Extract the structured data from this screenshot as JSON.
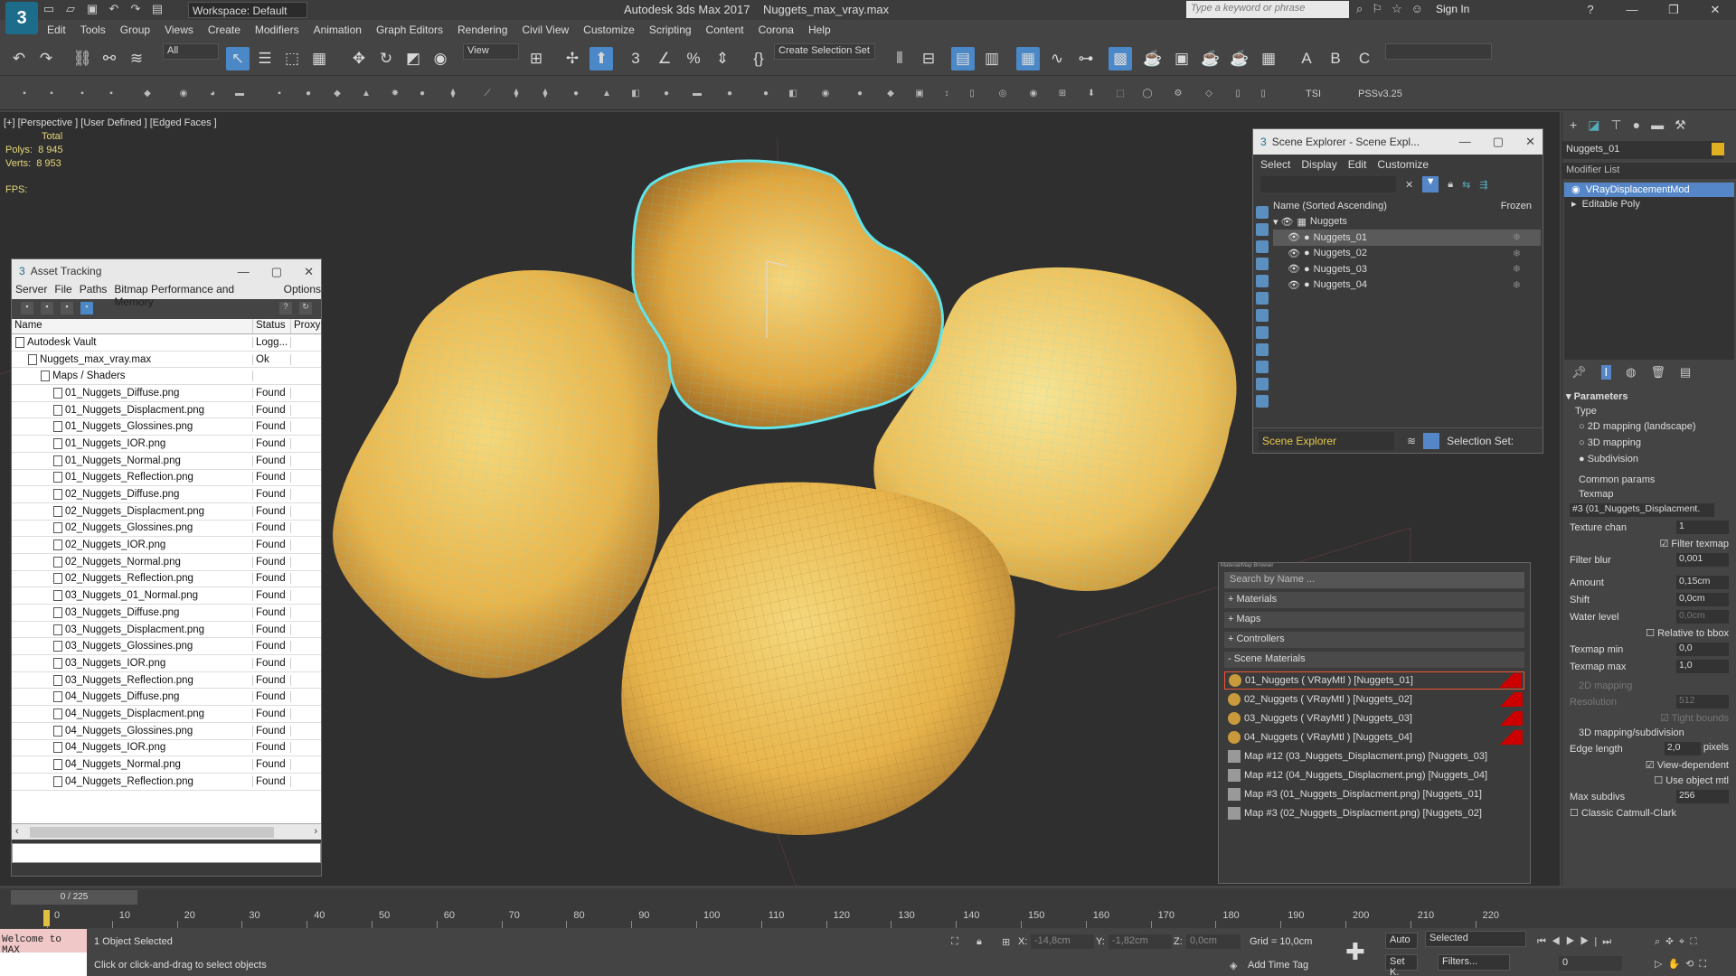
{
  "titlebar": {
    "workspace": "Workspace: Default",
    "app_name": "Autodesk 3ds Max 2017",
    "file_name": "Nuggets_max_vray.max",
    "search_placeholder": "Type a keyword or phrase",
    "sign_in": "Sign In"
  },
  "menu": [
    "Edit",
    "Tools",
    "Group",
    "Views",
    "Create",
    "Modifiers",
    "Animation",
    "Graph Editors",
    "Rendering",
    "Civil View",
    "Customize",
    "Scripting",
    "Content",
    "Corona",
    "Help"
  ],
  "toolbar": {
    "filter_all": "All",
    "ref_coord": "View",
    "selection_set": "Create Selection Set",
    "tsi_label": "TSI",
    "pss_label": "PSSv3.25"
  },
  "viewport": {
    "label": "[+] [Perspective ] [User Defined ] [Edged Faces ]",
    "total_label": "Total",
    "polys_label": "Polys:",
    "polys_value": "8 945",
    "verts_label": "Verts:",
    "verts_value": "8 953",
    "fps_label": "FPS:"
  },
  "asset_tracking": {
    "title": "Asset Tracking",
    "menu": [
      "Server",
      "File",
      "Paths",
      "Bitmap Performance and Memory",
      "Options"
    ],
    "col_name": "Name",
    "col_status": "Status",
    "col_proxy": "Proxy",
    "rows": [
      {
        "name": "Autodesk Vault",
        "status": "Logg...",
        "indent": 0
      },
      {
        "name": "Nuggets_max_vray.max",
        "status": "Ok",
        "indent": 1
      },
      {
        "name": "Maps / Shaders",
        "status": "",
        "indent": 2
      },
      {
        "name": "01_Nuggets_Diffuse.png",
        "status": "Found",
        "indent": 3
      },
      {
        "name": "01_Nuggets_Displacment.png",
        "status": "Found",
        "indent": 3
      },
      {
        "name": "01_Nuggets_Glossines.png",
        "status": "Found",
        "indent": 3
      },
      {
        "name": "01_Nuggets_IOR.png",
        "status": "Found",
        "indent": 3
      },
      {
        "name": "01_Nuggets_Normal.png",
        "status": "Found",
        "indent": 3
      },
      {
        "name": "01_Nuggets_Reflection.png",
        "status": "Found",
        "indent": 3
      },
      {
        "name": "02_Nuggets_Diffuse.png",
        "status": "Found",
        "indent": 3
      },
      {
        "name": "02_Nuggets_Displacment.png",
        "status": "Found",
        "indent": 3
      },
      {
        "name": "02_Nuggets_Glossines.png",
        "status": "Found",
        "indent": 3
      },
      {
        "name": "02_Nuggets_IOR.png",
        "status": "Found",
        "indent": 3
      },
      {
        "name": "02_Nuggets_Normal.png",
        "status": "Found",
        "indent": 3
      },
      {
        "name": "02_Nuggets_Reflection.png",
        "status": "Found",
        "indent": 3
      },
      {
        "name": "03_Nuggets_01_Normal.png",
        "status": "Found",
        "indent": 3
      },
      {
        "name": "03_Nuggets_Diffuse.png",
        "status": "Found",
        "indent": 3
      },
      {
        "name": "03_Nuggets_Displacment.png",
        "status": "Found",
        "indent": 3
      },
      {
        "name": "03_Nuggets_Glossines.png",
        "status": "Found",
        "indent": 3
      },
      {
        "name": "03_Nuggets_IOR.png",
        "status": "Found",
        "indent": 3
      },
      {
        "name": "03_Nuggets_Reflection.png",
        "status": "Found",
        "indent": 3
      },
      {
        "name": "04_Nuggets_Diffuse.png",
        "status": "Found",
        "indent": 3
      },
      {
        "name": "04_Nuggets_Displacment.png",
        "status": "Found",
        "indent": 3
      },
      {
        "name": "04_Nuggets_Glossines.png",
        "status": "Found",
        "indent": 3
      },
      {
        "name": "04_Nuggets_IOR.png",
        "status": "Found",
        "indent": 3
      },
      {
        "name": "04_Nuggets_Normal.png",
        "status": "Found",
        "indent": 3
      },
      {
        "name": "04_Nuggets_Reflection.png",
        "status": "Found",
        "indent": 3
      }
    ]
  },
  "scene_explorer": {
    "title": "Scene Explorer - Scene Expl...",
    "menu": [
      "Select",
      "Display",
      "Edit",
      "Customize"
    ],
    "col_name": "Name (Sorted Ascending)",
    "col_frozen": "Frozen",
    "items": [
      {
        "name": "Nuggets",
        "level": 0,
        "selected": false
      },
      {
        "name": "Nuggets_01",
        "level": 1,
        "selected": true
      },
      {
        "name": "Nuggets_02",
        "level": 1,
        "selected": false
      },
      {
        "name": "Nuggets_03",
        "level": 1,
        "selected": false
      },
      {
        "name": "Nuggets_04",
        "level": 1,
        "selected": false
      }
    ],
    "footer_label": "Scene Explorer",
    "selection_set_label": "Selection Set:"
  },
  "material_browser": {
    "title": "Material/Map Browser",
    "search_placeholder": "Search by Name ...",
    "sections": [
      "+ Materials",
      "+ Maps",
      "+ Controllers",
      "- Scene Materials"
    ],
    "items": [
      {
        "label": "01_Nuggets  ( VRayMtl )  [Nuggets_01]",
        "kind": "mtl",
        "highlight": true
      },
      {
        "label": "02_Nuggets  ( VRayMtl )  [Nuggets_02]",
        "kind": "mtl",
        "highlight": false
      },
      {
        "label": "03_Nuggets  ( VRayMtl )  [Nuggets_03]",
        "kind": "mtl",
        "highlight": false
      },
      {
        "label": "04_Nuggets  ( VRayMtl )  [Nuggets_04]",
        "kind": "mtl",
        "highlight": false
      },
      {
        "label": "Map #12 (03_Nuggets_Displacment.png)  [Nuggets_03]",
        "kind": "map",
        "highlight": false
      },
      {
        "label": "Map #12 (04_Nuggets_Displacment.png)  [Nuggets_04]",
        "kind": "map",
        "highlight": false
      },
      {
        "label": "Map #3 (01_Nuggets_Displacment.png)  [Nuggets_01]",
        "kind": "map",
        "highlight": false
      },
      {
        "label": "Map #3 (02_Nuggets_Displacment.png)  [Nuggets_02]",
        "kind": "map",
        "highlight": false
      }
    ]
  },
  "command_panel": {
    "object_name": "Nuggets_01",
    "modifier_list": "Modifier List",
    "stack": [
      "VRayDisplacementMod",
      "Editable Poly"
    ],
    "parameters_title": "Parameters",
    "type_label": "Type",
    "type_options": [
      "2D mapping (landscape)",
      "3D mapping",
      "Subdivision"
    ],
    "common_params": "Common params",
    "texmap_label": "Texmap",
    "texmap_value": "#3 (01_Nuggets_Displacment.",
    "texture_chan_label": "Texture chan",
    "texture_chan_value": "1",
    "filter_texmap": "Filter texmap",
    "filter_blur_label": "Filter blur",
    "filter_blur_value": "0,001",
    "amount_label": "Amount",
    "amount_value": "0,15cm",
    "shift_label": "Shift",
    "shift_value": "0,0cm",
    "water_level_label": "Water level",
    "water_level_value": "0,0cm",
    "relative_bbox": "Relative to bbox",
    "texmap_min_label": "Texmap min",
    "texmap_min_value": "0,0",
    "texmap_max_label": "Texmap max",
    "texmap_max_value": "1,0",
    "mapping_2d": "2D mapping",
    "resolution_label": "Resolution",
    "resolution_value": "512",
    "tight_bounds": "Tight bounds",
    "mapping_3d_sub": "3D mapping/subdivision",
    "edge_length_label": "Edge length",
    "edge_length_value": "2,0",
    "edge_length_unit": "pixels",
    "view_dependent": "View-dependent",
    "use_object_mtl": "Use object mtl",
    "max_subdivs_label": "Max subdivs",
    "max_subdivs_value": "256",
    "classic_catmull": "Classic Catmull-Clark"
  },
  "timeline": {
    "frame_display": "0 / 225",
    "ticks": [
      "0",
      "10",
      "20",
      "30",
      "40",
      "50",
      "60",
      "70",
      "80",
      "90",
      "100",
      "110",
      "120",
      "130",
      "140",
      "150",
      "160",
      "170",
      "180",
      "190",
      "200",
      "210",
      "220"
    ]
  },
  "statusbar": {
    "listener": "Welcome to MAX",
    "selection_status": "1 Object Selected",
    "prompt": "Click or click-and-drag to select objects",
    "x_label": "X:",
    "x_value": "-14,8cm",
    "y_label": "Y:",
    "y_value": "-1,82cm",
    "z_label": "Z:",
    "z_value": "0,0cm",
    "grid": "Grid = 10,0cm",
    "add_time_tag": "Add Time Tag",
    "auto": "Auto",
    "selected": "Selected",
    "set_k": "Set K.",
    "filters": "Filters...",
    "frame": "0"
  }
}
